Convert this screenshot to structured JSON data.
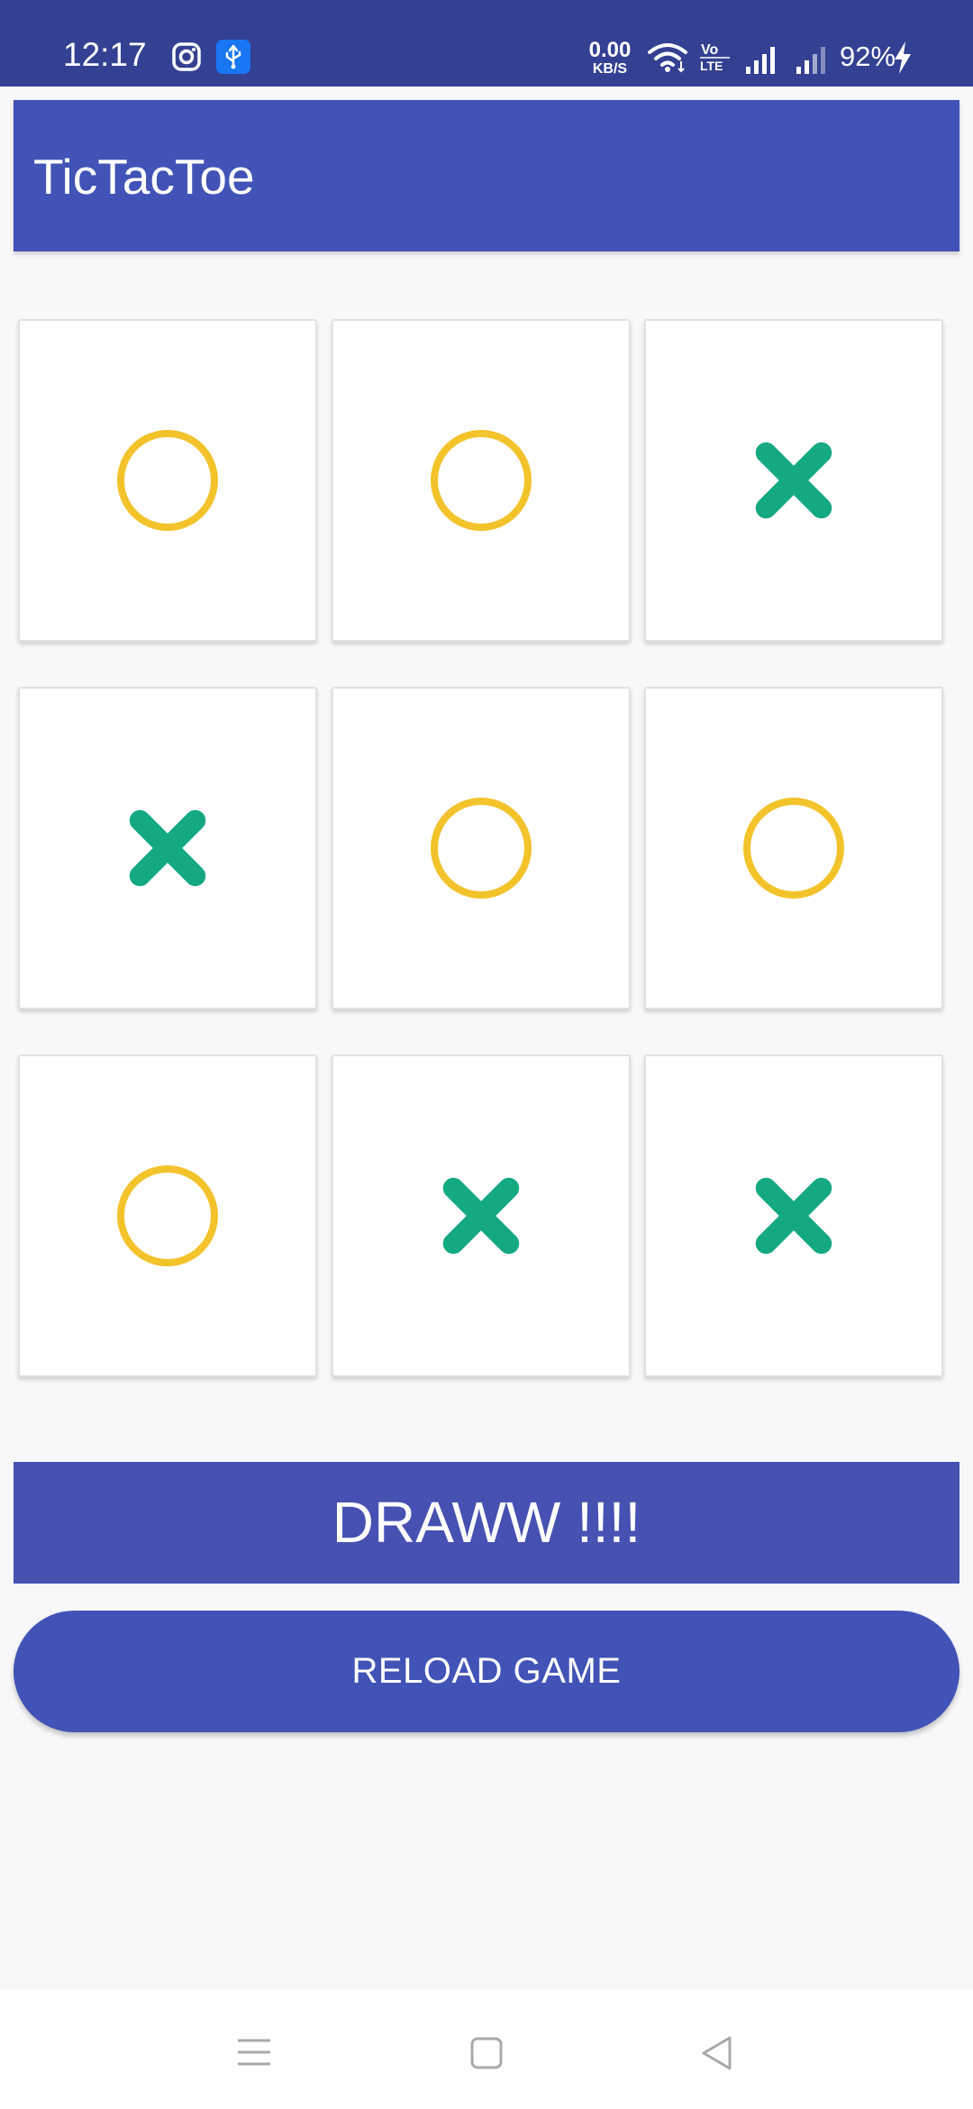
{
  "status_bar": {
    "time": "12:17",
    "left_icons": [
      "instagram-icon",
      "usb-icon"
    ],
    "net_speed_value": "0.00",
    "net_speed_unit": "KB/S",
    "right_icons": [
      "wifi-icon",
      "volte-icon",
      "signal-sim1-icon",
      "signal-sim2-icon",
      "charging-icon"
    ],
    "volte_label": "Vo LTE",
    "battery_percent": "92%"
  },
  "app_bar": {
    "title": "TicTacToe"
  },
  "board": {
    "rows": [
      [
        "O",
        "O",
        "X"
      ],
      [
        "X",
        "O",
        "O"
      ],
      [
        "O",
        "X",
        "X"
      ]
    ]
  },
  "result": {
    "text": "DRAWW !!!!"
  },
  "reload_button": {
    "label": "RELOAD GAME"
  },
  "nav_bar": {
    "buttons": [
      "menu-icon",
      "home-icon",
      "back-icon"
    ]
  },
  "colors": {
    "status_bar_bg": "#344092",
    "app_bar_bg": "#4153b6",
    "result_bg": "#4751b2",
    "button_bg": "#4153b6",
    "o_mark": "#f3c32b",
    "x_mark": "#15a982",
    "page_bg": "#f8f8fa"
  }
}
